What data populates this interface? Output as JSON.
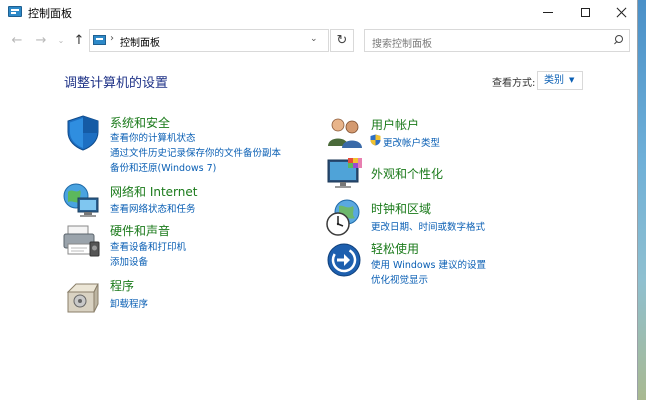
{
  "window": {
    "title": "控制面板"
  },
  "nav": {
    "back_glyph": "←",
    "forward_glyph": "→",
    "recent_glyph": "⌄",
    "up_glyph": "↑",
    "address_sep": "›",
    "address": "控制面板",
    "address_drop": "⌄",
    "refresh_glyph": "↻",
    "search_placeholder": "搜索控制面板"
  },
  "content": {
    "title": "调整计算机的设置",
    "view_by_label": "查看方式:",
    "view_by_value": "类别",
    "view_by_caret": "▼"
  },
  "categories": {
    "security": {
      "title": "系统和安全",
      "links": [
        "查看你的计算机状态",
        "通过文件历史记录保存你的文件备份副本",
        "备份和还原(Windows 7)"
      ]
    },
    "network": {
      "title": "网络和 Internet",
      "links": [
        "查看网络状态和任务"
      ]
    },
    "hardware": {
      "title": "硬件和声音",
      "links": [
        "查看设备和打印机",
        "添加设备"
      ]
    },
    "programs": {
      "title": "程序",
      "links": [
        "卸载程序"
      ]
    },
    "users": {
      "title": "用户帐户",
      "links": [
        "更改帐户类型"
      ]
    },
    "appearance": {
      "title": "外观和个性化",
      "links": []
    },
    "clock": {
      "title": "时钟和区域",
      "links": [
        "更改日期、时间或数字格式"
      ]
    },
    "ease": {
      "title": "轻松使用",
      "links": [
        "使用 Windows 建议的设置",
        "优化视觉显示"
      ]
    }
  },
  "colors": {
    "title_blue": "#1e3287",
    "category_green": "#1a7a1a",
    "link_blue": "#0a5fb4"
  }
}
